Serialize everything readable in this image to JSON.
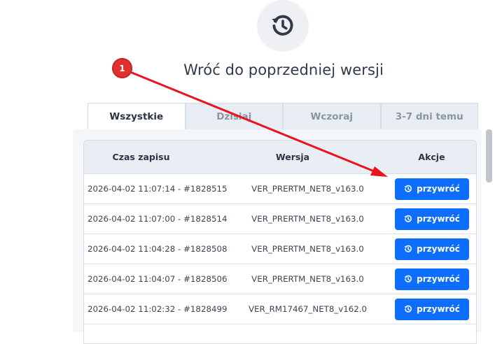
{
  "title": "Wróć do poprzedniej wersji",
  "tabs": [
    {
      "label": "Wszystkie"
    },
    {
      "label": "Dzisiaj"
    },
    {
      "label": "Wczoraj"
    },
    {
      "label": "3-7 dni temu"
    }
  ],
  "table": {
    "headers": {
      "time": "Czas zapisu",
      "version": "Wersja",
      "actions": "Akcje"
    },
    "rows": [
      {
        "time": "2026-04-02 11:07:14 - #1828515",
        "version": "VER_PRERTM_NET8_v163.0",
        "action": "przywróć"
      },
      {
        "time": "2026-04-02 11:07:00 - #1828514",
        "version": "VER_PRERTM_NET8_v163.0",
        "action": "przywróć"
      },
      {
        "time": "2026-04-02 11:04:28 - #1828508",
        "version": "VER_PRERTM_NET8_v163.0",
        "action": "przywróć"
      },
      {
        "time": "2026-04-02 11:04:07 - #1828506",
        "version": "VER_PRERTM_NET8_v163.0",
        "action": "przywróć"
      },
      {
        "time": "2026-04-02 11:02:32 - #1828499",
        "version": "VER_RM17467_NET8_v162.0",
        "action": "przywróć"
      }
    ]
  },
  "annotation": {
    "step": "1"
  },
  "colors": {
    "accent": "#0d6efd",
    "annotation": "#e03131"
  },
  "icons": {
    "header": "history-icon",
    "button": "restore-icon"
  }
}
